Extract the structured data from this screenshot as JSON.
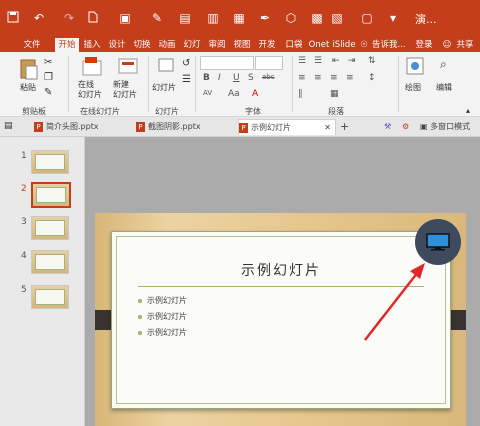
{
  "titlebar": {
    "title_fragment": "演..."
  },
  "tabs": [
    "文件",
    "开始",
    "插入",
    "设计",
    "切换",
    "动画",
    "幻灯",
    "审阅",
    "视图",
    "开发",
    "口袋",
    "Onet",
    "iSlide"
  ],
  "tell_me": "告诉我...",
  "login": "登录",
  "share": "共享",
  "ribbon": {
    "paste": "粘贴",
    "online_slides": "在线\n幻灯片",
    "new_slide": "新建\n幻灯片",
    "slide_btn": "幻灯片",
    "drawing": "绘图",
    "editing": "编辑",
    "groups": {
      "clipboard": "剪贴板",
      "online": "在线幻灯片",
      "slides": "幻灯片",
      "font": "字体",
      "paragraph": "段落"
    },
    "font_buttons": [
      "B",
      "I",
      "U",
      "S",
      "abc",
      "AV",
      "Aa",
      "A"
    ]
  },
  "doc_tabs": [
    {
      "name": "简介头图.pptx"
    },
    {
      "name": "截图阴影.pptx"
    },
    {
      "name": "示例幻灯片"
    }
  ],
  "multi_window": "多窗口模式",
  "thumbnails": [
    "1",
    "2",
    "3",
    "4",
    "5"
  ],
  "slide": {
    "title": "示例幻灯片",
    "bullets": [
      "示例幻灯片",
      "示例幻灯片",
      "示例幻灯片"
    ]
  },
  "colors": {
    "accent": "#c43e1c",
    "rule": "#a4b070",
    "arrow": "#e02828",
    "badge": "#3e4a5e",
    "monitor": "#2f8fd8"
  },
  "icons": [
    "save-icon",
    "undo-icon",
    "redo-icon",
    "new-file-icon",
    "monitor-icon",
    "lightbulb-icon",
    "person-icon",
    "close-icon",
    "plus-icon"
  ]
}
